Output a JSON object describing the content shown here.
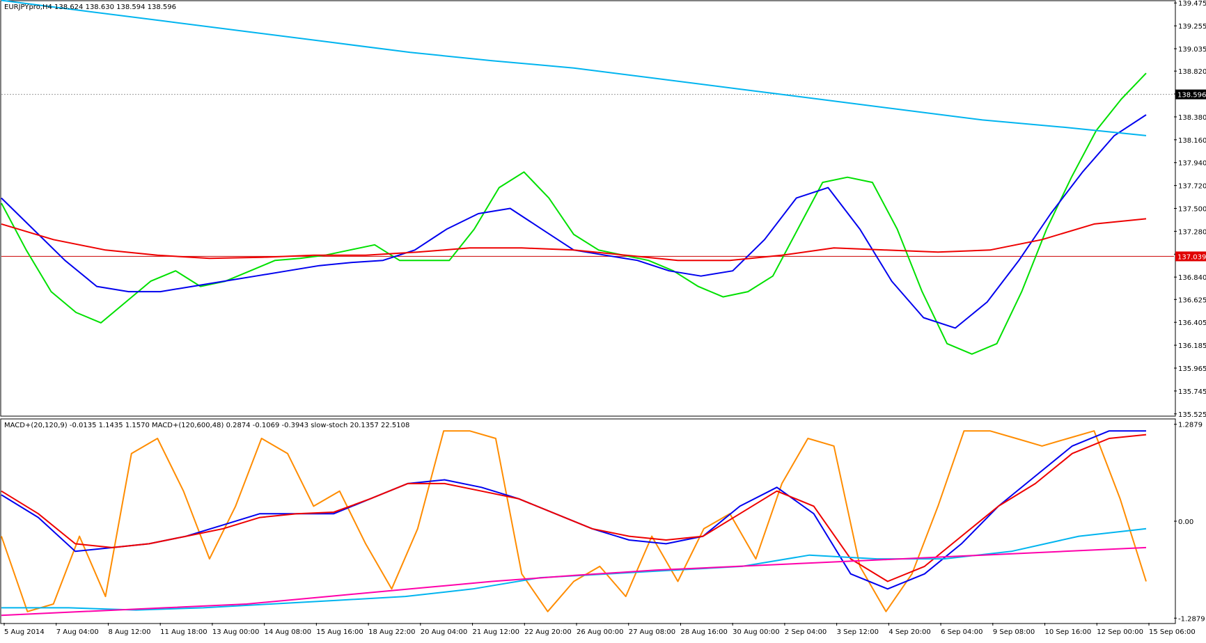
{
  "window": {
    "symbol_header": "EURJPYpro,H4  138.624 138.630 138.594 138.596",
    "indicator_header": "MACD+(20,120,9) -0.0135 1.1435 1.1570  MACD+(120,600,48) 0.2874 -0.1069 -0.3943  slow-stoch 20.1357 22.5108"
  },
  "chart_data": [
    {
      "type": "candlestick",
      "symbol": "EURJPYpro",
      "timeframe": "H4",
      "ohlc_last": {
        "open": 138.624,
        "high": 138.63,
        "low": 138.594,
        "close": 138.596
      },
      "y_ticks": [
        "139.475",
        "139.255",
        "139.035",
        "138.820",
        "138.600",
        "138.380",
        "138.160",
        "137.940",
        "137.720",
        "137.500",
        "137.280",
        "137.060",
        "136.840",
        "136.625",
        "136.405",
        "136.185",
        "135.965",
        "135.745",
        "135.525"
      ],
      "ylim": [
        135.51,
        139.49
      ],
      "current_price_label": "138.596",
      "horizontal_line_label": "137.039",
      "x_ticks": [
        "5 Aug 2014",
        "7 Aug 04:00",
        "8 Aug 12:00",
        "11 Aug 18:00",
        "13 Aug 00:00",
        "14 Aug 08:00",
        "15 Aug 16:00",
        "18 Aug 22:00",
        "20 Aug 04:00",
        "21 Aug 12:00",
        "22 Aug 20:00",
        "26 Aug 00:00",
        "27 Aug 08:00",
        "28 Aug 16:00",
        "30 Aug 00:00",
        "2 Sep 04:00",
        "3 Sep 12:00",
        "4 Sep 20:00",
        "6 Sep 04:00",
        "9 Sep 08:00",
        "10 Sep 16:00",
        "12 Sep 00:00",
        "15 Sep 06:00"
      ],
      "series": [
        {
          "name": "",
          "color": "#00e000",
          "values": [
            137.55,
            137.1,
            136.7,
            136.5,
            136.4,
            136.6,
            136.8,
            136.9,
            136.75,
            136.8,
            136.9,
            137.0,
            137.02,
            137.05,
            137.1,
            137.15,
            137.0,
            137.0,
            137.0,
            137.3,
            137.7,
            137.85,
            137.6,
            137.25,
            137.1,
            137.05,
            137.0,
            136.9,
            136.75,
            136.65,
            136.7,
            136.85,
            137.3,
            137.75,
            137.8,
            137.75,
            137.3,
            136.7,
            136.2,
            136.1,
            136.2,
            136.7,
            137.3,
            137.8,
            138.25,
            138.55,
            138.8
          ]
        },
        {
          "name": "",
          "color": "#0000ee",
          "values": [
            137.6,
            137.3,
            137.0,
            136.75,
            136.7,
            136.7,
            136.75,
            136.8,
            136.85,
            136.9,
            136.95,
            136.98,
            137.0,
            137.1,
            137.3,
            137.45,
            137.5,
            137.3,
            137.1,
            137.05,
            137.0,
            136.9,
            136.85,
            136.9,
            137.2,
            137.6,
            137.7,
            137.3,
            136.8,
            136.45,
            136.35,
            136.6,
            137.0,
            137.45,
            137.85,
            138.2,
            138.4
          ]
        },
        {
          "name": "",
          "color": "#ee0000",
          "values": [
            137.35,
            137.2,
            137.1,
            137.05,
            137.02,
            137.03,
            137.05,
            137.05,
            137.08,
            137.12,
            137.12,
            137.1,
            137.05,
            137.0,
            137.0,
            137.05,
            137.12,
            137.1,
            137.08,
            137.1,
            137.2,
            137.35,
            137.4
          ]
        },
        {
          "name": "",
          "color": "#00b4ef",
          "values": [
            139.5,
            139.4,
            139.3,
            139.2,
            139.1,
            139.0,
            138.92,
            138.85,
            138.75,
            138.65,
            138.55,
            138.45,
            138.35,
            138.28,
            138.2
          ]
        }
      ]
    },
    {
      "type": "line",
      "ylim": [
        -1.35,
        1.35
      ],
      "y_ticks": [
        "1.2879",
        "0.00",
        "-1.2879"
      ],
      "series": [
        {
          "name": "",
          "color": "#ff8c00",
          "values": [
            -0.2,
            -1.2,
            -1.1,
            -0.2,
            -1.0,
            0.9,
            1.1,
            0.4,
            -0.5,
            0.2,
            1.1,
            0.9,
            0.2,
            0.4,
            -0.3,
            -0.9,
            -0.1,
            1.2,
            1.2,
            1.1,
            -0.7,
            -1.2,
            -0.8,
            -0.6,
            -1.0,
            -0.2,
            -0.8,
            -0.1,
            0.1,
            -0.5,
            0.5,
            1.1,
            1.0,
            -0.6,
            -1.2,
            -0.7,
            0.2,
            1.2,
            1.2,
            1.1,
            1.0,
            1.1,
            1.2,
            0.3,
            -0.8
          ]
        },
        {
          "name": "",
          "color": "#0000ee",
          "values": [
            0.35,
            0.05,
            -0.4,
            -0.35,
            -0.3,
            -0.2,
            -0.05,
            0.1,
            0.1,
            0.1,
            0.3,
            0.5,
            0.55,
            0.45,
            0.3,
            0.1,
            -0.1,
            -0.25,
            -0.3,
            -0.2,
            0.2,
            0.45,
            0.1,
            -0.7,
            -0.9,
            -0.7,
            -0.3,
            0.2,
            0.6,
            1.0,
            1.2,
            1.2
          ]
        },
        {
          "name": "",
          "color": "#ee0000",
          "values": [
            0.4,
            0.1,
            -0.3,
            -0.35,
            -0.3,
            -0.2,
            -0.1,
            0.05,
            0.1,
            0.12,
            0.3,
            0.5,
            0.5,
            0.4,
            0.3,
            0.1,
            -0.1,
            -0.2,
            -0.25,
            -0.2,
            0.1,
            0.4,
            0.2,
            -0.5,
            -0.8,
            -0.6,
            -0.2,
            0.2,
            0.5,
            0.9,
            1.1,
            1.15
          ]
        },
        {
          "name": "",
          "color": "#00b4ef",
          "values": [
            -1.15,
            -1.15,
            -1.18,
            -1.15,
            -1.1,
            -1.05,
            -1.0,
            -0.9,
            -0.75,
            -0.7,
            -0.65,
            -0.6,
            -0.45,
            -0.5,
            -0.5,
            -0.4,
            -0.2,
            -0.1
          ]
        },
        {
          "name": "",
          "color": "#ff00aa",
          "values": [
            -1.25,
            -1.2,
            -1.15,
            -1.1,
            -1.0,
            -0.9,
            -0.8,
            -0.72,
            -0.65,
            -0.6,
            -0.55,
            -0.5,
            -0.45,
            -0.4,
            -0.35
          ]
        }
      ]
    }
  ]
}
